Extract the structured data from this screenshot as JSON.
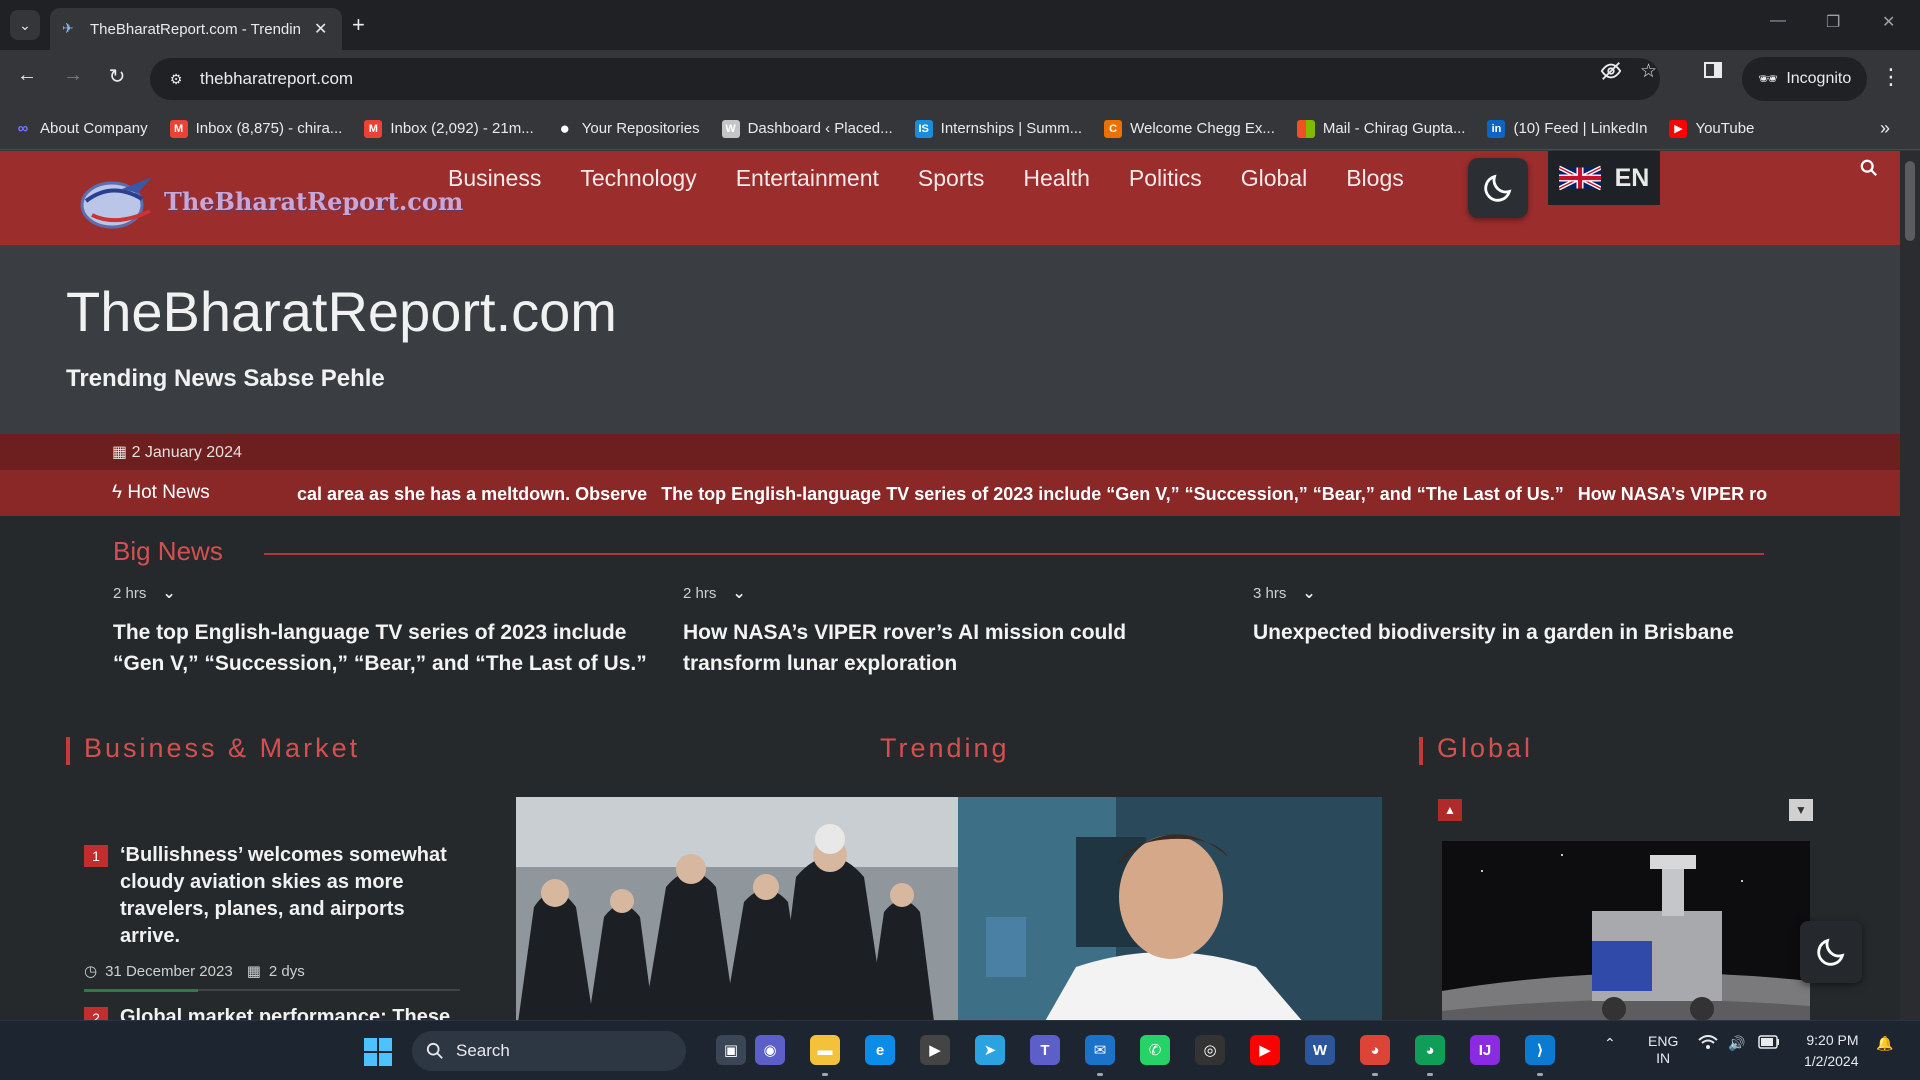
{
  "browser": {
    "tab_title": "TheBharatReport.com - Trendin",
    "url": "thebharatreport.com",
    "incognito_label": "Incognito",
    "bookmarks": [
      {
        "label": "About Company",
        "icon": "link-icon",
        "color": "#6b7cff"
      },
      {
        "label": "Inbox (8,875) - chira...",
        "icon": "gmail-icon",
        "color": "#ea4335"
      },
      {
        "label": "Inbox (2,092) - 21m...",
        "icon": "gmail-icon",
        "color": "#ea4335"
      },
      {
        "label": "Your Repositories",
        "icon": "github-icon",
        "color": "#ffffff"
      },
      {
        "label": "Dashboard ‹ Placed...",
        "icon": "wordpress-icon",
        "color": "#c5c5c5"
      },
      {
        "label": "Internships | Summ...",
        "icon": "internshala-icon",
        "color": "#1c8bd9"
      },
      {
        "label": "Welcome Chegg Ex...",
        "icon": "chegg-icon",
        "color": "#eb7100"
      },
      {
        "label": "Mail - Chirag Gupta...",
        "icon": "microsoft-icon",
        "color": "#f25022"
      },
      {
        "label": "(10) Feed | LinkedIn",
        "icon": "linkedin-icon",
        "color": "#0a66c2"
      },
      {
        "label": "YouTube",
        "icon": "youtube-icon",
        "color": "#ff0000"
      }
    ]
  },
  "site": {
    "logo_text": "TheBharatReport.com",
    "menu": [
      "Business",
      "Technology",
      "Entertainment",
      "Sports",
      "Health",
      "Politics",
      "Global",
      "Blogs"
    ],
    "lang": "EN",
    "hero_title": "TheBharatReport.com",
    "tagline": "Trending News Sabse Pehle",
    "date": "2 January 2024",
    "hot_label": "Hot News",
    "ticker": [
      "cal area as she has a meltdown. Observe",
      "The top English-language TV series of 2023 include “Gen V,” “Succession,” “Bear,” and “The Last of Us.”",
      "How NASA’s VIPER rover’s AI mission coul"
    ],
    "big_news_title": "Big News",
    "big_news": [
      {
        "time": "2 hrs",
        "headline": "The top English-language TV series of 2023 include “Gen V,” “Succession,” “Bear,” and “The Last of Us.”"
      },
      {
        "time": "2 hrs",
        "headline": "How NASA’s VIPER rover’s AI mission could transform lunar exploration"
      },
      {
        "time": "3 hrs",
        "headline": "Unexpected biodiversity in a garden in Brisbane"
      }
    ],
    "business_title": "Business & Market",
    "trending_title": "Trending",
    "global_title": "Global",
    "business_items": [
      {
        "num": "1",
        "headline": "‘Bullishness’ welcomes somewhat cloudy aviation skies as more travelers, planes, and airports arrive.",
        "date": "31 December 2023",
        "age": "2 dys"
      },
      {
        "num": "2",
        "headline": "Global market performance: These"
      }
    ]
  },
  "taskbar": {
    "search_label": "Search",
    "lang_top": "ENG",
    "lang_bottom": "IN",
    "time": "9:20 PM",
    "date": "1/2/2024"
  },
  "colors": {
    "nav_bg": "#9b2d2d",
    "accent_red": "#d45050",
    "hero_bg": "#3a3e42",
    "page_bg": "#26292b"
  }
}
